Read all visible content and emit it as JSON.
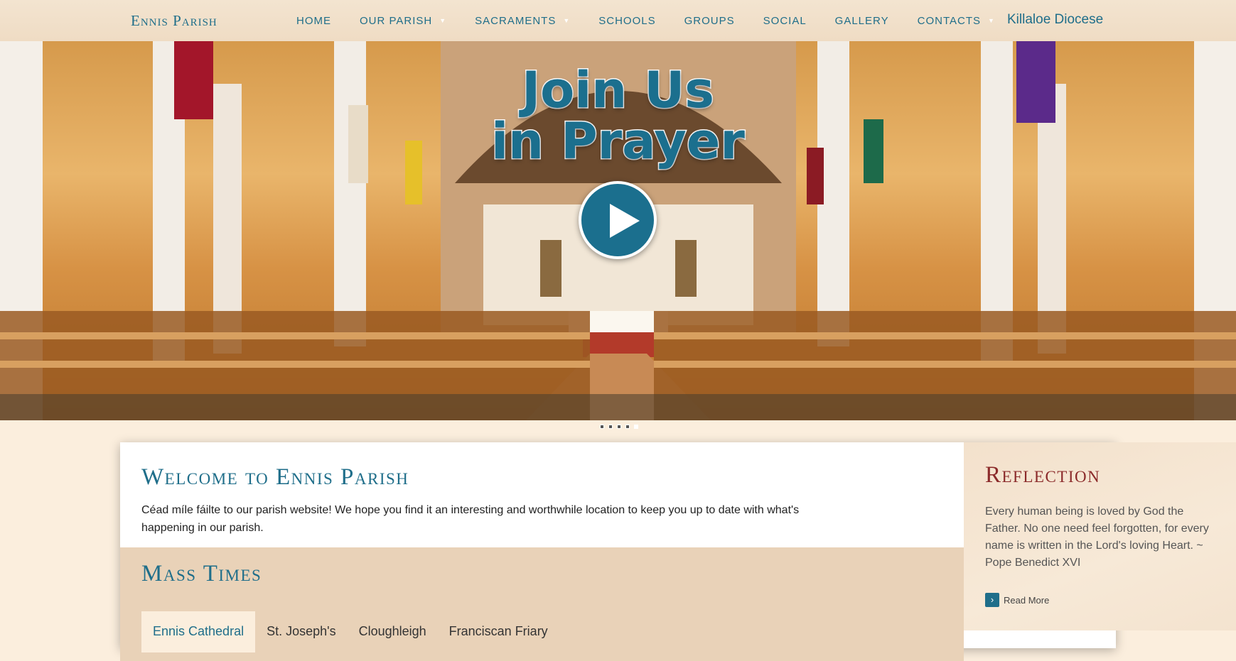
{
  "header": {
    "brand": "Ennis Parish",
    "nav": [
      {
        "label": "HOME",
        "has_dropdown": false
      },
      {
        "label": "OUR PARISH",
        "has_dropdown": true
      },
      {
        "label": "SACRAMENTS",
        "has_dropdown": true
      },
      {
        "label": "SCHOOLS",
        "has_dropdown": false
      },
      {
        "label": "GROUPS",
        "has_dropdown": false
      },
      {
        "label": "SOCIAL",
        "has_dropdown": false
      },
      {
        "label": "GALLERY",
        "has_dropdown": false
      },
      {
        "label": "CONTACTS",
        "has_dropdown": true
      }
    ],
    "diocese_link": "Killaloe Diocese"
  },
  "hero": {
    "line1": "Join Us",
    "line2": "in Prayer",
    "play_icon": "play-icon",
    "slide_count": 5,
    "active_slide": 5
  },
  "welcome": {
    "title": "Welcome to Ennis Parish",
    "text": "Céad míle fáilte to our parish website! We hope you find it an interesting and worthwhile location to keep you up to date with what's happening in our parish."
  },
  "mass_times": {
    "title": "Mass Times",
    "tabs": [
      "Ennis Cathedral",
      "St. Joseph's",
      "Cloughleigh",
      "Franciscan Friary"
    ],
    "active_tab": 0
  },
  "reflection": {
    "title": "Reflection",
    "text": "Every human being is loved by God the Father. No one need feel forgotten, for every name is written in the Lord's loving Heart. ~ Pope Benedict XVI",
    "read_more": "Read More",
    "read_more_icon": "chevron-right-icon"
  },
  "colors": {
    "accent": "#1f6e8a",
    "reflection_title": "#8b2a2a",
    "page_bg": "#fbeedd",
    "mass_bg": "#e9d2b8"
  }
}
